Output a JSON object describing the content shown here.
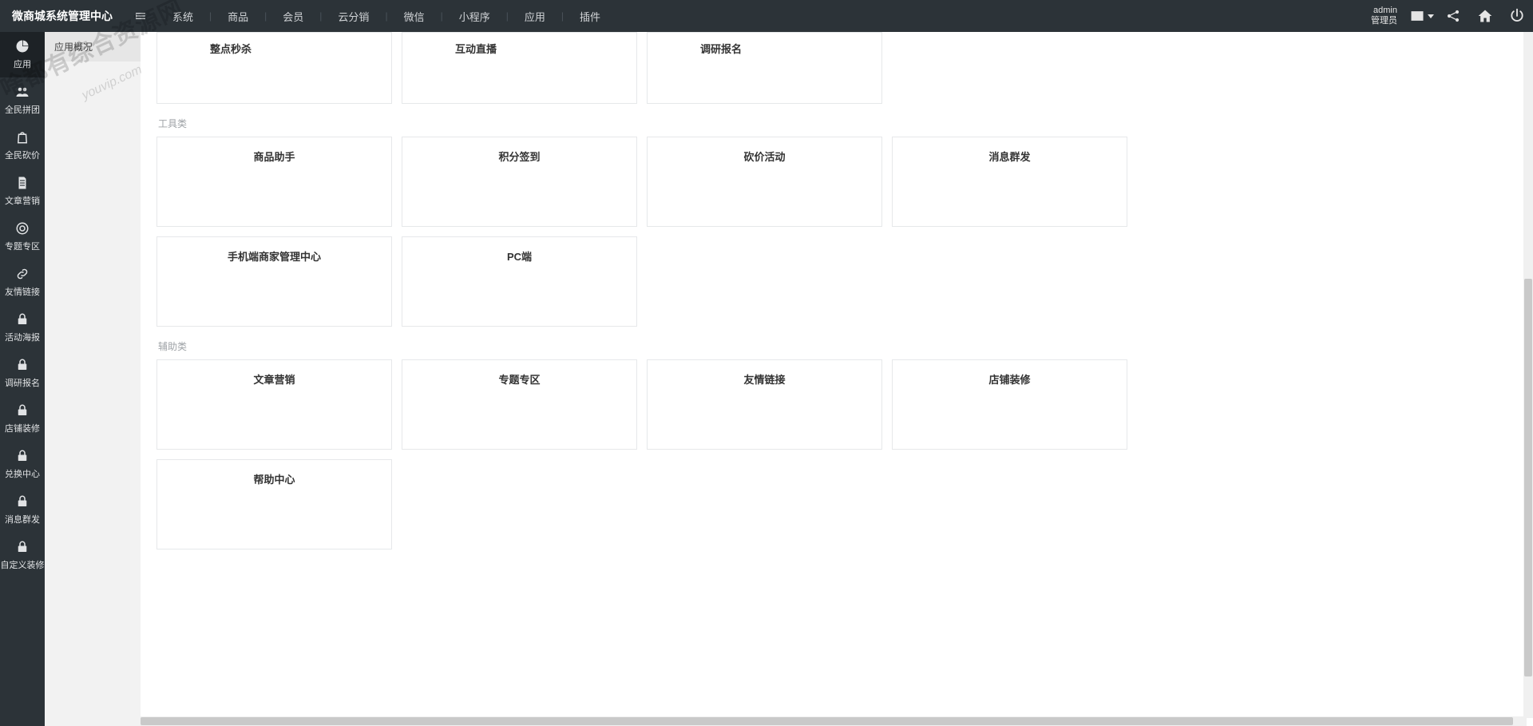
{
  "header": {
    "logo": "微商城系统管理中心",
    "nav": [
      "系统",
      "商品",
      "会员",
      "云分销",
      "微信",
      "小程序",
      "应用",
      "插件"
    ],
    "user_name": "admin",
    "user_role": "管理员"
  },
  "sidebar": {
    "items": [
      {
        "label": "应用",
        "icon": "pie"
      },
      {
        "label": "全民拼团",
        "icon": "group"
      },
      {
        "label": "全民砍价",
        "icon": "bag"
      },
      {
        "label": "文章营销",
        "icon": "doc"
      },
      {
        "label": "专题专区",
        "icon": "target"
      },
      {
        "label": "友情链接",
        "icon": "link"
      },
      {
        "label": "活动海报",
        "icon": "lock"
      },
      {
        "label": "调研报名",
        "icon": "lock"
      },
      {
        "label": "店铺装修",
        "icon": "lock"
      },
      {
        "label": "兑换中心",
        "icon": "lock"
      },
      {
        "label": "消息群发",
        "icon": "lock"
      },
      {
        "label": "自定义装修",
        "icon": "lock"
      }
    ]
  },
  "secondary": {
    "items": [
      "应用概况"
    ]
  },
  "content": {
    "top_row": [
      "整点秒杀",
      "互动直播",
      "调研报名"
    ],
    "cat_tools": "工具类",
    "tools_row1": [
      "商品助手",
      "积分签到",
      "砍价活动",
      "消息群发"
    ],
    "tools_row2": [
      "手机端商家管理中心",
      "PC端"
    ],
    "cat_assist": "辅助类",
    "assist_row1": [
      "文章营销",
      "专题专区",
      "友情链接",
      "店铺装修"
    ],
    "assist_row2": [
      "帮助中心"
    ]
  },
  "watermark": {
    "main": "啥都有综合资源网",
    "sub": "youvip.com"
  }
}
